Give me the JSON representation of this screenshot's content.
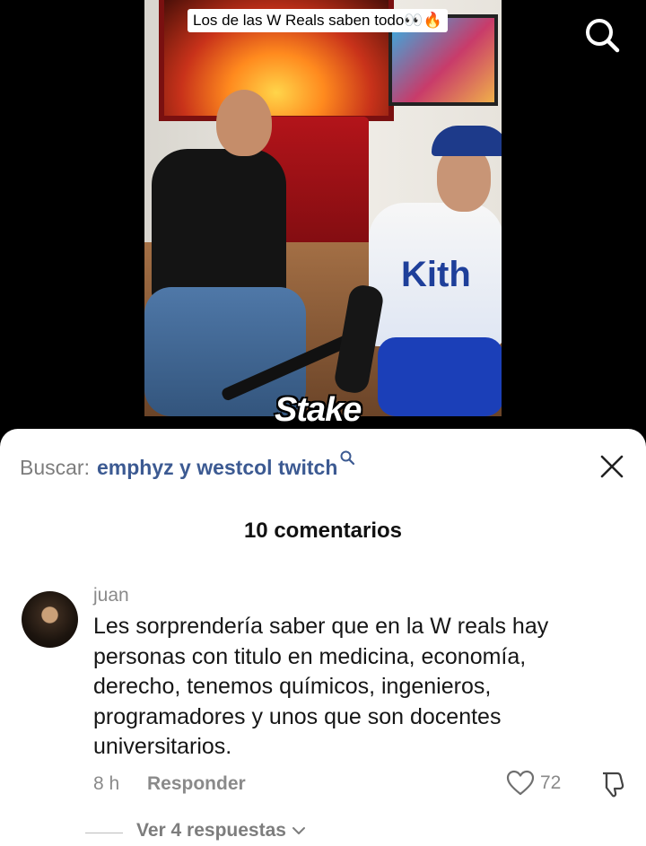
{
  "video": {
    "caption": "Los de las W Reals saben todo👀🔥",
    "watermark": "Stake",
    "shirt_brand": "Kith",
    "search_icon": "search-icon"
  },
  "comments_sheet": {
    "search_prefix": "Buscar:",
    "search_query": "emphyz y westcol twitch",
    "search_icon": "search-icon",
    "close_icon": "close-icon",
    "count_title": "10 comentarios",
    "comment": {
      "username": "juan",
      "text": "Les sorprendería saber que en la W reals hay personas con titulo en medicina, economía, derecho, tenemos químicos, ingenieros, programadores y unos que son docentes universitarios.",
      "time": "8 h",
      "reply_label": "Responder",
      "likes": "72",
      "like_icon": "heart-icon",
      "dislike_icon": "thumbs-down-icon",
      "view_replies": "Ver 4 respuestas",
      "view_replies_icon": "chevron-down-icon"
    }
  },
  "colors": {
    "query_blue": "#3c5a92",
    "muted_gray": "#8a8a8a",
    "sheet_bg": "#ffffff",
    "video_bg": "#000000"
  }
}
